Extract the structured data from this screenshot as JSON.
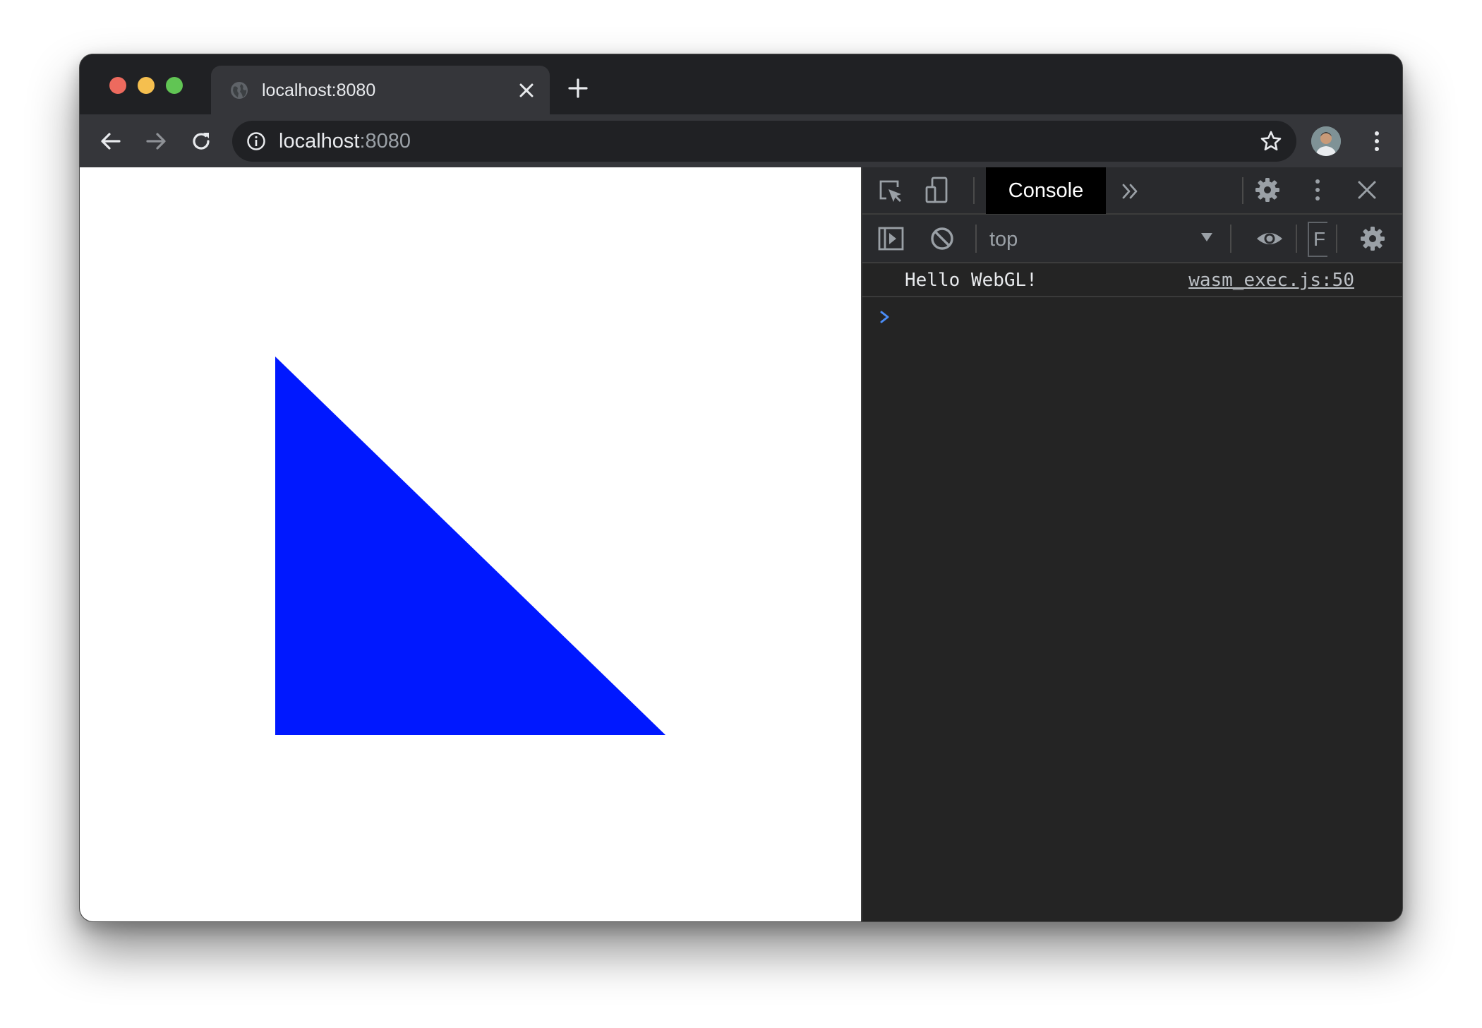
{
  "browser": {
    "tab": {
      "title": "localhost:8080"
    },
    "address_bar": {
      "host": "localhost",
      "port": ":8080"
    }
  },
  "page": {
    "canvas_fill_color": "#0018ff",
    "background_color": "#ffffff"
  },
  "devtools": {
    "active_tab": "Console",
    "context_selector": "top",
    "filter_label": "F",
    "messages": [
      {
        "text": "Hello WebGL!",
        "source": "wasm_exec.js:50"
      }
    ],
    "prompt_symbol": "›"
  },
  "colors": {
    "traffic_red": "#ed6a5e",
    "traffic_yellow": "#f5bf4f",
    "traffic_green": "#61c554",
    "prompt_blue": "#4a8cf6"
  }
}
